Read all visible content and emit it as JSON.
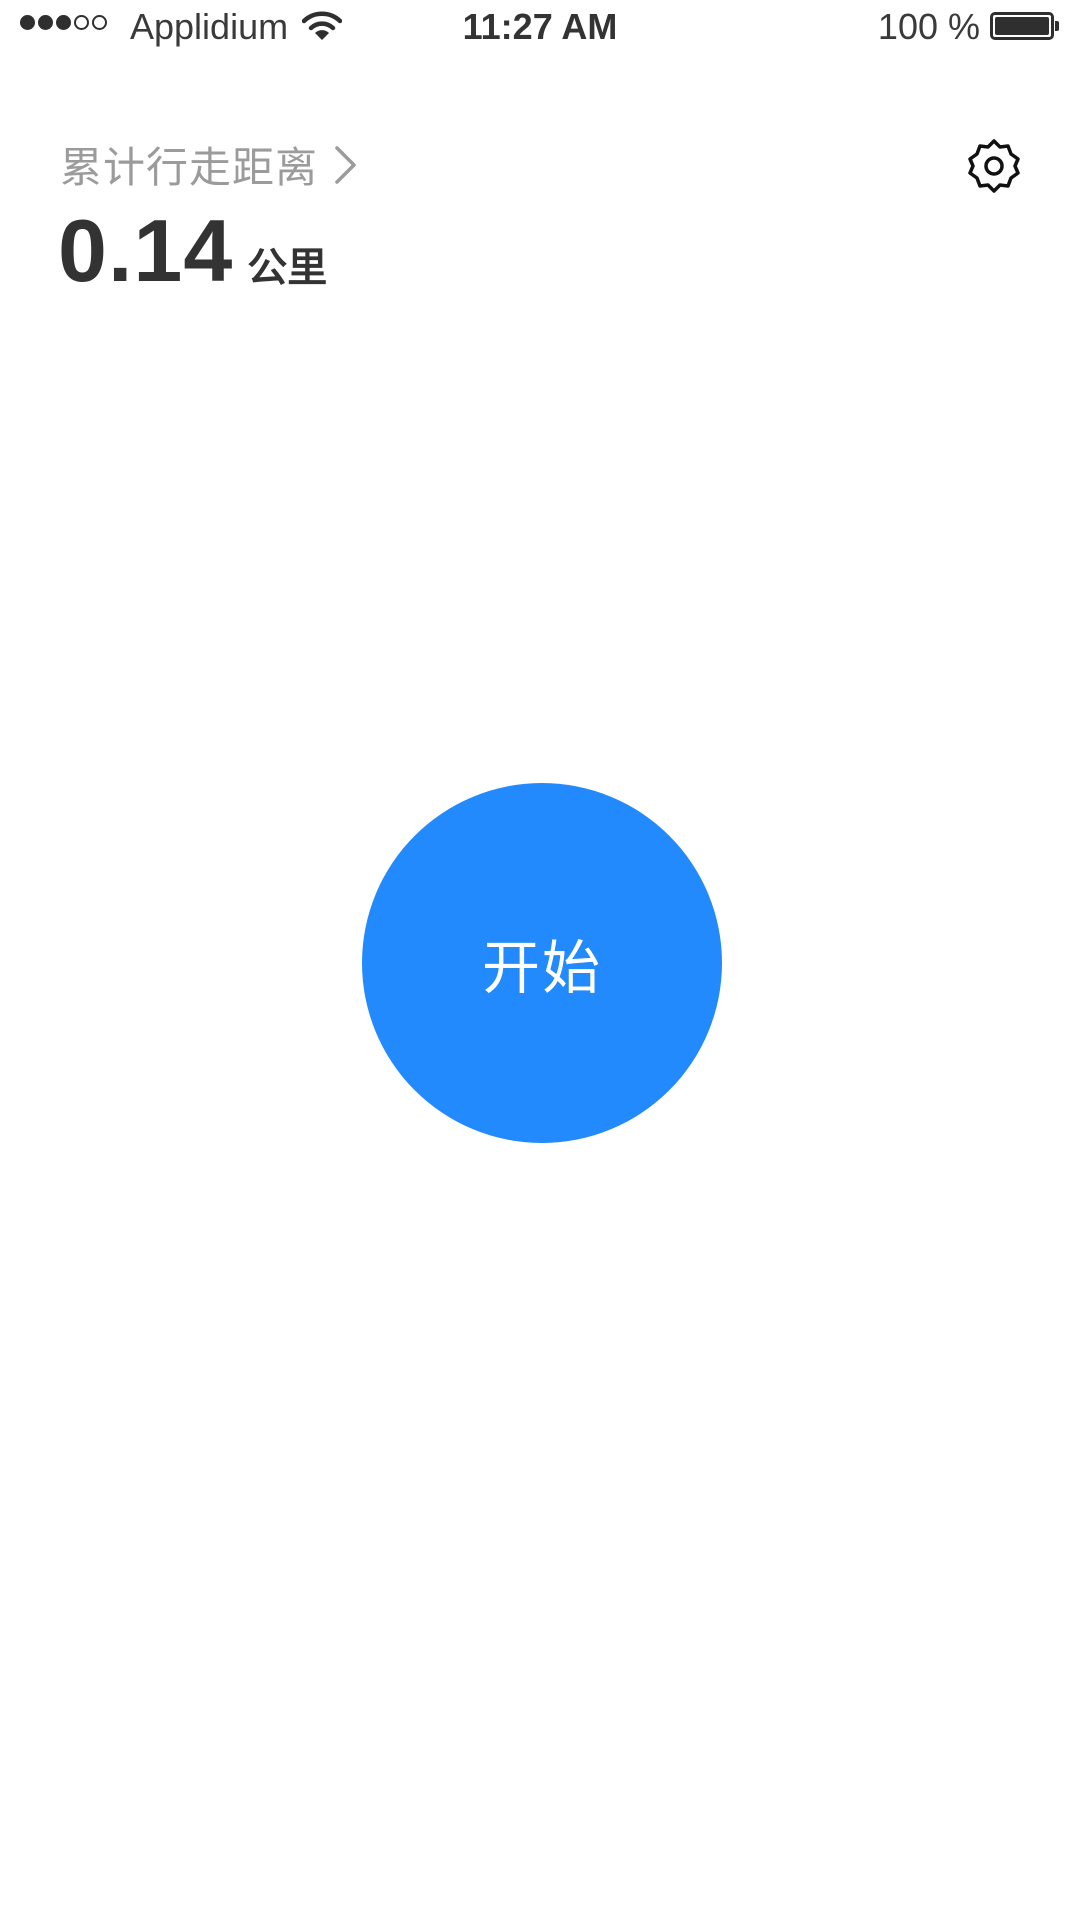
{
  "status_bar": {
    "carrier": "Applidium",
    "time": "11:27 AM",
    "battery_text": "100 %",
    "battery_level": 1.0,
    "signal_bars_filled": 3,
    "signal_bars_total": 5,
    "icons": [
      "signal-icon",
      "wifi-icon",
      "battery-icon"
    ]
  },
  "header": {
    "distance_label": "累计行走距离",
    "distance_value": "0.14",
    "distance_unit": "公里",
    "icons": [
      "chevron-right-icon",
      "gear-icon"
    ]
  },
  "main": {
    "start_label": "开始"
  },
  "colors": {
    "accent": "#228afd",
    "label_gray": "#9b9b9b",
    "text_dark": "#333333",
    "background": "#ffffff"
  }
}
